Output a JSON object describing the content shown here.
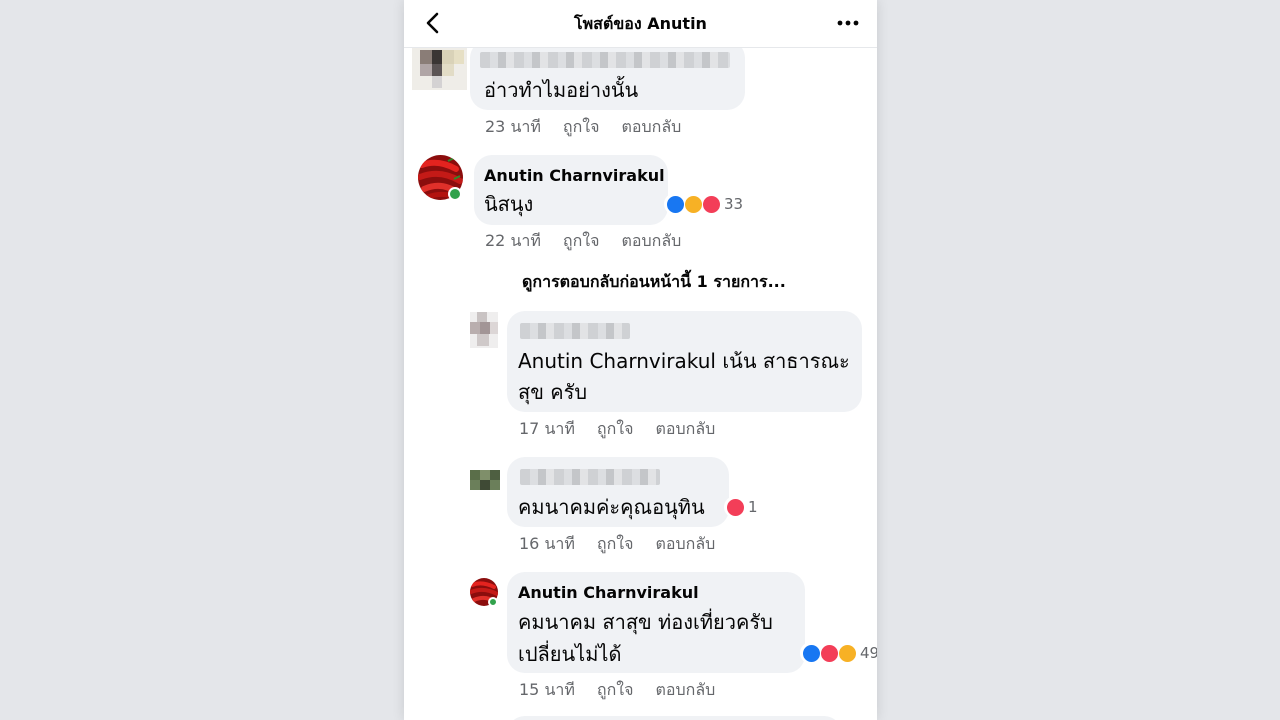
{
  "header": {
    "title": "โพสต์ของ Anutin"
  },
  "comments": [
    {
      "text": "อ่าวทำไมอย่างนั้น",
      "time": "23 นาที",
      "like": "ถูกใจ",
      "reply": "ตอบกลับ"
    },
    {
      "name": "Anutin Charnvirakul",
      "text": "นิสนุง",
      "reaction_count": "33",
      "time": "22 นาที",
      "like": "ถูกใจ",
      "reply": "ตอบกลับ"
    }
  ],
  "view_previous": "ดูการตอบกลับก่อนหน้านี้ 1 รายการ...",
  "replies": [
    {
      "text_line1": "Anutin Charnvirakul เน้น สาธารณะ",
      "text_line2": "สุข ครับ",
      "time": "17 นาที",
      "like": "ถูกใจ",
      "reply": "ตอบกลับ"
    },
    {
      "text": "คมนาคมค่ะคุณอนุทิน",
      "reaction_count": "1",
      "time": "16 นาที",
      "like": "ถูกใจ",
      "reply": "ตอบกลับ"
    },
    {
      "name": "Anutin Charnvirakul",
      "text_line1": "คมนาคม สาสุข ท่องเที่ยวครับ",
      "text_line2": "เปลี่ยนไม่ได้",
      "reaction_count": "49",
      "time": "15 นาที",
      "like": "ถูกใจ",
      "reply": "ตอบกลับ"
    }
  ],
  "colors": {
    "bubble": "#f0f2f5",
    "online": "#31a24c",
    "like": "#1877f2",
    "love": "#f33e58",
    "haha": "#f7b125",
    "meta": "#65676b"
  }
}
